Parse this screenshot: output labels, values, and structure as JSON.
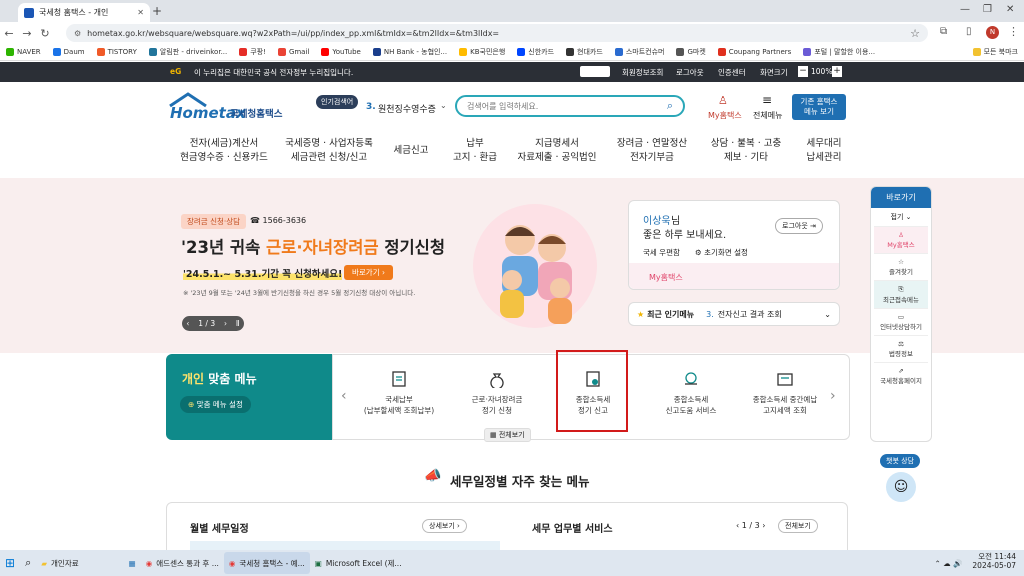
{
  "browser": {
    "tab_title": "국세청 홈택스 - 개인",
    "url": "hometax.go.kr/websquare/websquare.wq?w2xPath=/ui/pp/index_pp.xml&tmIdx=&tm2lIdx=&tm3lIdx=",
    "bookmarks": [
      "NAVER",
      "Daum",
      "TISTORY",
      "알림판 - driveinkor...",
      "쿠팡!",
      "Gmail",
      "YouTube",
      "NH Bank - 농협인...",
      "KB국민은행",
      "신한카드",
      "현대카드",
      "스마트컨슈머",
      "G마켓",
      "Coupang Partners",
      "포털 | 말할한 이용..."
    ],
    "bookmarks_more": "모든 북마크"
  },
  "gov_strip": {
    "notice": "이 누리집은 대한민국 공식 전자정부 누리집입니다.",
    "links": [
      "회원정보조회",
      "로그아웃",
      "인증센터",
      "화면크기"
    ],
    "zoom": "100%"
  },
  "header": {
    "logo_text": "Hometax",
    "logo_sub": "국세청홈택스",
    "popular_label": "인기검색어",
    "popular_rank": "3.",
    "popular_term": "원천징수영수증",
    "search_placeholder": "검색어를 입력하세요.",
    "my_label": "My홈택스",
    "menu_label": "전체메뉴",
    "old_btn": "기존 홈택스 메뉴 보기"
  },
  "gnb": [
    [
      "전자(세금)계산서",
      "현금영수증 · 신용카드"
    ],
    [
      "국세증명 · 사업자등록",
      "세금관련 신청/신고"
    ],
    [
      "세금신고"
    ],
    [
      "납부",
      "고지 · 환급"
    ],
    [
      "지급명세서",
      "자료제출 · 공익법인"
    ],
    [
      "장려금 · 연말정산",
      "전자기부금"
    ],
    [
      "상담 · 불복 · 고충",
      "제보 · 기타"
    ],
    [
      "세무대리",
      "납세관리"
    ]
  ],
  "hero": {
    "tag": "장려금 신청·상담",
    "phone": "☎ 1566-3636",
    "title_pre": "'23년 귀속 ",
    "title_hl": "근로·자녀장려금",
    "title_post": " 정기신청",
    "period": "'24.5.1.~ 5.31.기간 꼭 신청하세요!",
    "go_btn": "바로가기",
    "note": "※ '23년 9월 또는 '24년 3월에 반기신청을 하신 경우 5월 정기신청 대상이 아닙니다.",
    "pager": "1 / 3"
  },
  "user_card": {
    "name": "이상욱",
    "name_suffix": "님",
    "greeting": "좋은 하루 보내세요.",
    "logout": "로그아웃",
    "mailbox": "국세 우편함",
    "init_setting": "초기화면 설정",
    "my_link": "My홈택스",
    "popular_label": "최근 인기메뉴",
    "popular_rank": "3.",
    "popular_item": "전자신고 결과 조회"
  },
  "personal_menu": {
    "title_hl": "개인",
    "title_rest": " 맞춤 메뉴",
    "setting_btn": "맞춤 메뉴 설정",
    "items": [
      [
        "국세납부",
        "(납부할세액 조회납부)"
      ],
      [
        "근로·자녀장려금",
        "정기 신청"
      ],
      [
        "종합소득세",
        "정기 신고"
      ],
      [
        "종합소득세",
        "신고도움 서비스"
      ],
      [
        "종합소득세 중간예납",
        "고지세액 조회"
      ]
    ],
    "all_btn": "전체보기"
  },
  "side_quick": {
    "title": "바로가기",
    "fold": "접기",
    "items": [
      "My홈택스",
      "즐겨찾기",
      "최근접속메뉴",
      "인터넷상담하기",
      "법령정보",
      "국세청홈페이지"
    ],
    "chatbot": "챗봇 상담"
  },
  "schedule": {
    "title": "세무일정별 자주 찾는 메뉴",
    "monthly": "월별 세무일정",
    "more": "상세보기",
    "service": "세무 업무별 서비스",
    "service_pager": "1 / 3",
    "service_all": "전체보기"
  },
  "taskbar": {
    "items": [
      "개인자료",
      "애드센스 통과 후 ...",
      "국세청 홈택스 - 예...",
      "Microsoft Excel (제..."
    ],
    "time": "오전 11:44",
    "date": "2024-05-07"
  },
  "colors": {
    "accent": "#1f6fb2",
    "teal": "#0f8a8a",
    "orange": "#f07a1b",
    "pink": "#e0446a",
    "red_box": "#d21a1a"
  }
}
